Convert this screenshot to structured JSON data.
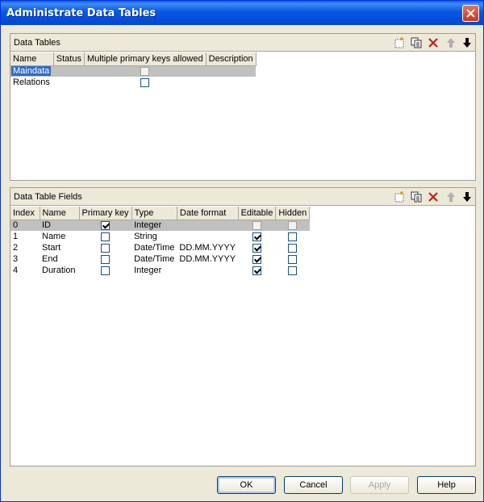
{
  "window": {
    "title": "Administrate Data Tables"
  },
  "tables_panel": {
    "title": "Data Tables",
    "columns": [
      "Name",
      "Status",
      "Multiple primary keys allowed",
      "Description"
    ],
    "rows": [
      {
        "name": "Maindata",
        "status": "",
        "multiple_pk": false,
        "description": "",
        "selected": true
      },
      {
        "name": "Relations",
        "status": "",
        "multiple_pk": false,
        "description": "",
        "selected": false
      }
    ]
  },
  "fields_panel": {
    "title": "Data Table Fields",
    "columns": [
      "Index",
      "Name",
      "Primary key",
      "Type",
      "Date format",
      "Editable",
      "Hidden"
    ],
    "rows": [
      {
        "index": "0",
        "name": "ID",
        "primary_key": true,
        "type": "Integer",
        "date_format": "",
        "editable": false,
        "hidden": false,
        "selected": true
      },
      {
        "index": "1",
        "name": "Name",
        "primary_key": false,
        "type": "String",
        "date_format": "",
        "editable": true,
        "hidden": false,
        "selected": false
      },
      {
        "index": "2",
        "name": "Start",
        "primary_key": false,
        "type": "Date/Time",
        "date_format": "DD.MM.YYYY",
        "editable": true,
        "hidden": false,
        "selected": false
      },
      {
        "index": "3",
        "name": "End",
        "primary_key": false,
        "type": "Date/Time",
        "date_format": "DD.MM.YYYY",
        "editable": true,
        "hidden": false,
        "selected": false
      },
      {
        "index": "4",
        "name": "Duration",
        "primary_key": false,
        "type": "Integer",
        "date_format": "",
        "editable": true,
        "hidden": false,
        "selected": false
      }
    ]
  },
  "buttons": {
    "ok": "OK",
    "cancel": "Cancel",
    "apply": "Apply",
    "help": "Help"
  },
  "icons": [
    "new-icon",
    "copy-icon",
    "delete-icon",
    "move-up-icon",
    "move-down-icon",
    "close-icon"
  ]
}
